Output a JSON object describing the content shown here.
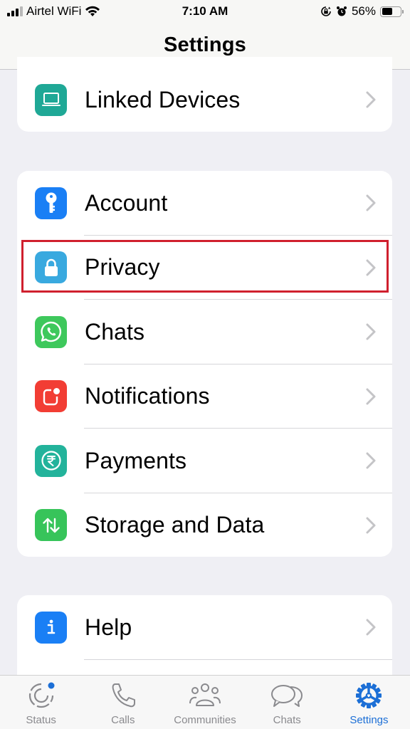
{
  "status_bar": {
    "carrier": "Airtel WiFi",
    "time": "7:10 AM",
    "battery_percent_label": "56%",
    "battery_level": 0.56,
    "signal_bars_active": 3,
    "signal_bars_total": 4,
    "icons": [
      "signal-icon",
      "wifi-icon",
      "orientation-lock-icon",
      "alarm-icon",
      "battery-icon"
    ]
  },
  "header": {
    "title": "Settings"
  },
  "sections": [
    {
      "items": [
        {
          "label": "Linked Devices",
          "icon": "laptop-icon",
          "color": "#1fa896"
        }
      ]
    },
    {
      "items": [
        {
          "label": "Account",
          "icon": "key-icon",
          "color": "#1a7ff5"
        },
        {
          "label": "Privacy",
          "icon": "lock-icon",
          "color": "#39a9df",
          "highlighted": true
        },
        {
          "label": "Chats",
          "icon": "whatsapp-icon",
          "color": "#3ec85c"
        },
        {
          "label": "Notifications",
          "icon": "notification-icon",
          "color": "#f23d34"
        },
        {
          "label": "Payments",
          "icon": "rupee-icon",
          "color": "#23b39b"
        },
        {
          "label": "Storage and Data",
          "icon": "arrows-up-down-icon",
          "color": "#37c45a"
        }
      ]
    },
    {
      "items": [
        {
          "label": "Help",
          "icon": "info-icon",
          "color": "#1a7ff5"
        }
      ]
    }
  ],
  "highlight_color": "#d0202e",
  "tab_bar": {
    "active_color": "#1c6fd6",
    "inactive_color": "#8a8a8e",
    "tabs": [
      {
        "label": "Status",
        "icon": "status-icon",
        "active": false,
        "badge": true
      },
      {
        "label": "Calls",
        "icon": "phone-icon",
        "active": false
      },
      {
        "label": "Communities",
        "icon": "communities-icon",
        "active": false
      },
      {
        "label": "Chats",
        "icon": "chats-icon",
        "active": false
      },
      {
        "label": "Settings",
        "icon": "settings-gear-icon",
        "active": true
      }
    ]
  }
}
